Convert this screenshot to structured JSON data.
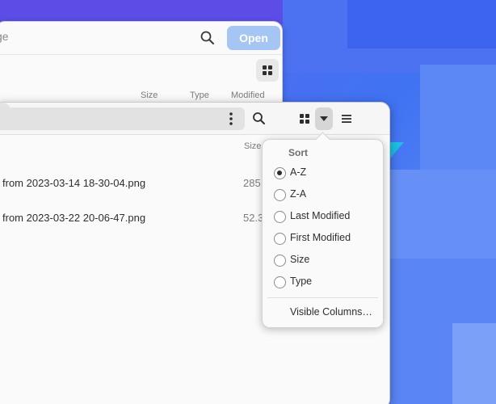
{
  "back_window": {
    "search_hint": "ge",
    "open_label": "Open",
    "columns": [
      "Size",
      "Type",
      "Modified"
    ]
  },
  "front_window": {
    "column_size": "Size",
    "files": [
      {
        "name": "from 2023-03-14 18-30-04.png",
        "size": "285"
      },
      {
        "name": "from 2023-03-22 20-06-47.png",
        "size": "52.3"
      }
    ]
  },
  "sort_menu": {
    "title": "Sort",
    "options": [
      {
        "label": "A-Z",
        "checked": true
      },
      {
        "label": "Z-A",
        "checked": false
      },
      {
        "label": "Last Modified",
        "checked": false
      },
      {
        "label": "First Modified",
        "checked": false
      },
      {
        "label": "Size",
        "checked": false
      },
      {
        "label": "Type",
        "checked": false
      }
    ],
    "visible_columns": "Visible Columns…"
  },
  "icons": {
    "search": "search-icon",
    "grid": "grid-view-icon",
    "dropdown": "chevron-down-icon",
    "menu": "hamburger-menu-icon",
    "close": "close-icon",
    "kebab": "kebab-menu-icon"
  },
  "colors": {
    "accent_disabled": "#a5c6f4",
    "window_bg": "#fafafa"
  }
}
